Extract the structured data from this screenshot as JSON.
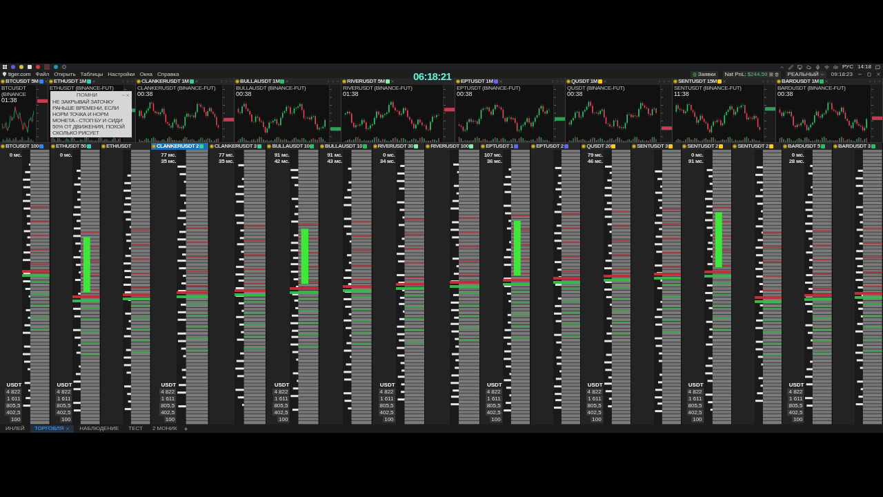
{
  "taskbar": {
    "language": "РУС",
    "time": "14:18"
  },
  "menu_bar": {
    "logo": "tiger.com",
    "items": [
      "Файл",
      "Открыть",
      "Таблицы",
      "Настройки",
      "Окна",
      "Справка"
    ],
    "orders_button": "Заявки",
    "pnl_label": "Nat PnL:",
    "pnl_value": "$244.59",
    "account_mode": "РЕАЛЬНЫЙ",
    "clock": "09:18:23"
  },
  "overlay_clock": "06:18:21",
  "charts": [
    {
      "title": "BTCUSDT 5M",
      "color": "#3b82f6",
      "source": "BTCUSDT (BINANCE",
      "countdown": "01:38"
    },
    {
      "title": "ETHUSDT 1M",
      "color": "#2dd4bf",
      "nav_buttons": true,
      "source": "ETHUSDT (BINANCE-FUT)"
    },
    {
      "title": "CLANKERUSDT 1M",
      "color": "#34d399",
      "nav_buttons": true,
      "source": "CLANKERUSDT (BINANCE-FUT)",
      "countdown": "00:38"
    },
    {
      "title": "BULLAUSDT 1M",
      "color": "#22c55e",
      "nav_buttons": true,
      "source": "BULLAUSDT (BINANCE-FUT)",
      "countdown": "00:38"
    },
    {
      "title": "RIVERUSDT 5M",
      "color": "#86efac",
      "nav_buttons": false,
      "source": "RIVERUSDT (BINANCE-FUT)",
      "countdown": "01:38"
    },
    {
      "title": "EPTUSDT 1M",
      "color": "#6366f1",
      "nav_buttons": true,
      "source": "EPTUSDT (BINANCE-FUT)",
      "countdown": "00:38"
    },
    {
      "title": "QUSDT 1M",
      "color": "#facc15",
      "nav_buttons": true,
      "source": "QUSDT (BINANCE-FUT)",
      "countdown": "00:38"
    },
    {
      "title": "SENTUSDT 15M",
      "color": "#facc15",
      "nav_buttons": true,
      "source": "SENTUSDT (BINANCE-FUT)",
      "countdown": "11:38"
    },
    {
      "title": "BARDUSDT 1M",
      "color": "#22c55e",
      "nav_buttons": true,
      "source": "BARDUSDT (BINANCE-FUT)",
      "countdown": "00:38"
    }
  ],
  "note": {
    "title": "ПОМНИ",
    "text": "НЕ ЗАКРЫВАЙ ЗАТОЧКУ РАНЬШЕ ВРЕМЕНИ, ЕСЛИ НОРМ ТОЧКА И НОРМ МОНЕТА - СТОП БУ И СИДИ 50% ОТ ДВИЖЕНИЯ, ПОХОЙ СКОЛЬКО РИСУЕТ"
  },
  "ladders": [
    {
      "title": "BTCUSDT 100",
      "selected": false,
      "color": "#3b82f6",
      "stats": [
        "0 мс."
      ],
      "currency": "USDT",
      "presets": [
        "4 822",
        "1 611",
        "805,5",
        "402,5",
        "100"
      ]
    },
    {
      "title": "ETHUSDT 50",
      "selected": false,
      "color": "#2dd4bf",
      "stats": [
        "0 мс."
      ],
      "currency": "USDT",
      "presets": [
        "4 822",
        "1 611",
        "805,5",
        "402,5",
        "100"
      ]
    },
    {
      "title": "ETH/USDT",
      "selected": false
    },
    {
      "title": "CLANKERUSDT 2",
      "selected": true,
      "color": "#34d399",
      "stats": [
        "77 мс.",
        "35 мс."
      ],
      "currency": "USDT",
      "presets": [
        "4 822",
        "1 611",
        "805,5",
        "402,5",
        "100"
      ]
    },
    {
      "title": "CLANKERUSDT 3",
      "selected": false,
      "color": "#34d399",
      "stats": [
        "77 мс.",
        "35 мс."
      ]
    },
    {
      "title": "BULLAUSDT 10",
      "selected": false,
      "color": "#22c55e",
      "stats": [
        "91 мс.",
        "42 мс."
      ],
      "currency": "USDT",
      "presets": [
        "4 822",
        "1 611",
        "805,5",
        "402,5",
        "100"
      ]
    },
    {
      "title": "BULLAUSDT 10",
      "selected": false,
      "color": "#22c55e",
      "stats": [
        "91 мс.",
        "43 мс."
      ]
    },
    {
      "title": "RIVERUSDT 30",
      "selected": false,
      "color": "#86efac",
      "stats": [
        "0 мс.",
        "34 мс."
      ],
      "currency": "USDT",
      "presets": [
        "4 822",
        "1 611",
        "805,5",
        "402,5",
        "100"
      ]
    },
    {
      "title": "RIVERUSDT 100",
      "selected": false,
      "color": "#86efac"
    },
    {
      "title": "EPTUSDT 1",
      "selected": false,
      "color": "#6366f1",
      "stats": [
        "107 мс.",
        "36 мс."
      ],
      "currency": "USDT",
      "presets": [
        "4 822",
        "1 611",
        "805,5",
        "402,5",
        "100"
      ]
    },
    {
      "title": "EPTUSDT 2",
      "selected": false,
      "color": "#6366f1"
    },
    {
      "title": "QUSDT 20",
      "selected": false,
      "color": "#facc15",
      "stats": [
        "79 мс.",
        "46 мс."
      ],
      "currency": "USDT",
      "presets": [
        "4 822",
        "1 611",
        "805,5",
        "402,5",
        "100"
      ]
    },
    {
      "title": "SENTUSDT 3",
      "selected": false,
      "color": "#facc15"
    },
    {
      "title": "SENTUSDT 2",
      "selected": false,
      "color": "#facc15",
      "stats": [
        "0 мс.",
        "91 мс."
      ],
      "currency": "USDT",
      "presets": [
        "4 822",
        "1 611",
        "805,5",
        "402,5",
        "100"
      ]
    },
    {
      "title": "SENTUSDT 2",
      "selected": false,
      "color": "#facc15"
    },
    {
      "title": "BARDUSDT 5",
      "selected": false,
      "color": "#22c55e",
      "stats": [
        "0 мс.",
        "28 мс."
      ],
      "currency": "USDT",
      "presets": [
        "4 822",
        "1 611",
        "805,5",
        "402,5",
        "100"
      ]
    },
    {
      "title": "BARDUSDT 3",
      "selected": false,
      "color": "#22c55e"
    }
  ],
  "bottom_tabs": [
    {
      "label": "ИНЛЕЙ",
      "selected": false
    },
    {
      "label": "ТОРГОВЛЯ",
      "selected": true
    },
    {
      "label": "НАБЛЮДЕНИЕ",
      "selected": false
    },
    {
      "label": "ТЕСТ",
      "selected": false
    },
    {
      "label": "2 МОНИК",
      "selected": false
    }
  ]
}
